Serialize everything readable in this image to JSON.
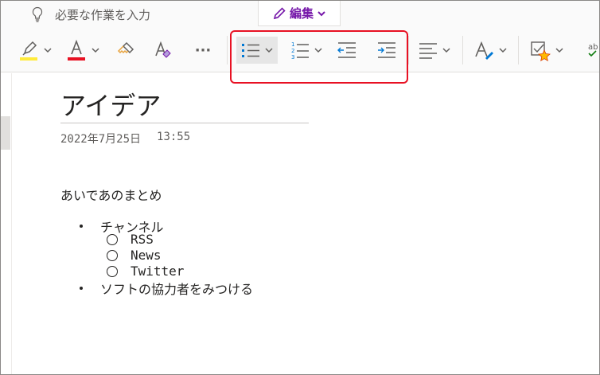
{
  "topbar": {
    "tell_me_placeholder": "必要な作業を入力",
    "edit_label": "編集"
  },
  "ribbon": {
    "highlight_color": "#ffeb3b",
    "font_color": "#e81123",
    "ellipsis": "···",
    "accent_color": "#0078d4"
  },
  "page": {
    "title": "アイデア",
    "date": "2022年7月25日",
    "time": "13:55",
    "intro": "あいであのまとめ",
    "list": [
      {
        "text": "チャンネル",
        "children": [
          "RSS",
          "News",
          "Twitter"
        ]
      },
      {
        "text": "ソフトの協力者をみつける",
        "children": []
      }
    ]
  }
}
